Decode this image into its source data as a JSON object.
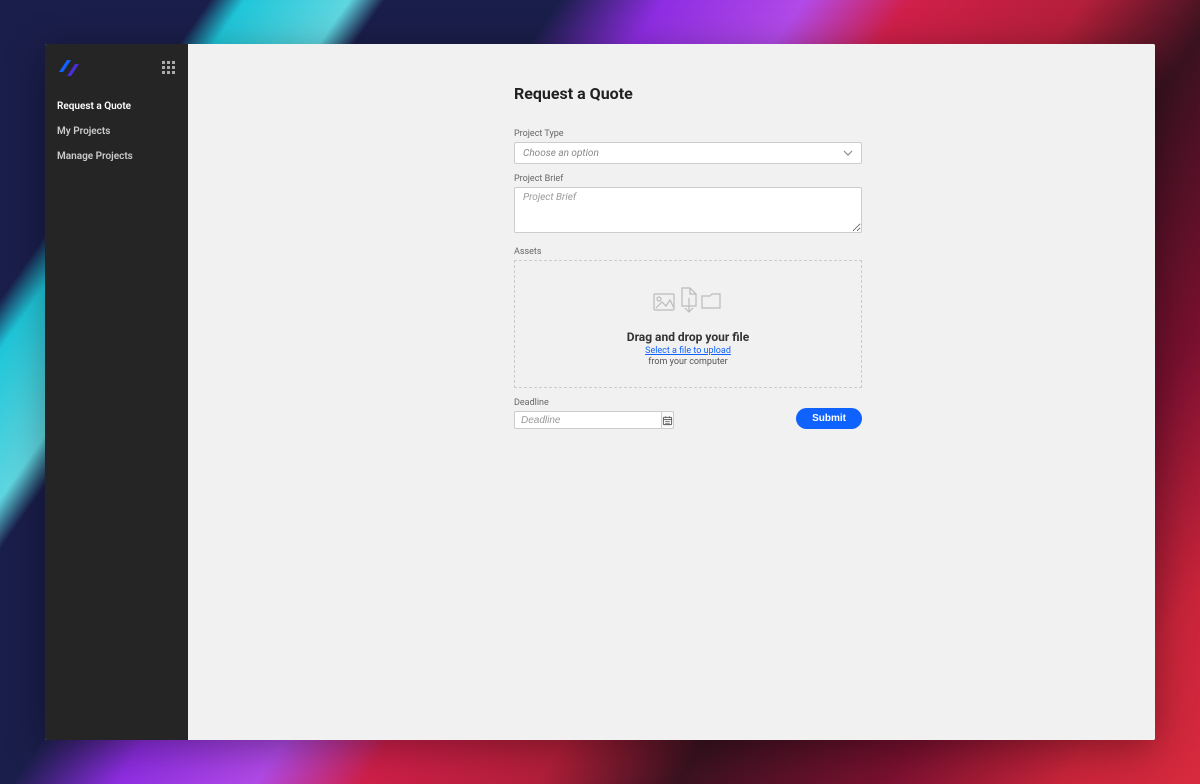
{
  "sidebar": {
    "items": [
      {
        "label": "Request a Quote",
        "active": true
      },
      {
        "label": "My Projects",
        "active": false
      },
      {
        "label": "Manage Projects",
        "active": false
      }
    ]
  },
  "page": {
    "title": "Request a Quote"
  },
  "form": {
    "project_type": {
      "label": "Project Type",
      "placeholder": "Choose an option"
    },
    "project_brief": {
      "label": "Project Brief",
      "placeholder": "Project Brief"
    },
    "assets": {
      "label": "Assets",
      "title": "Drag and drop your file",
      "link": "Select a file to upload",
      "sub": "from your computer"
    },
    "deadline": {
      "label": "Deadline",
      "placeholder": "Deadline"
    },
    "submit_label": "Submit"
  },
  "colors": {
    "primary": "#0f62fe",
    "sidebar_bg": "#252525",
    "page_bg": "#f1f1f1"
  }
}
